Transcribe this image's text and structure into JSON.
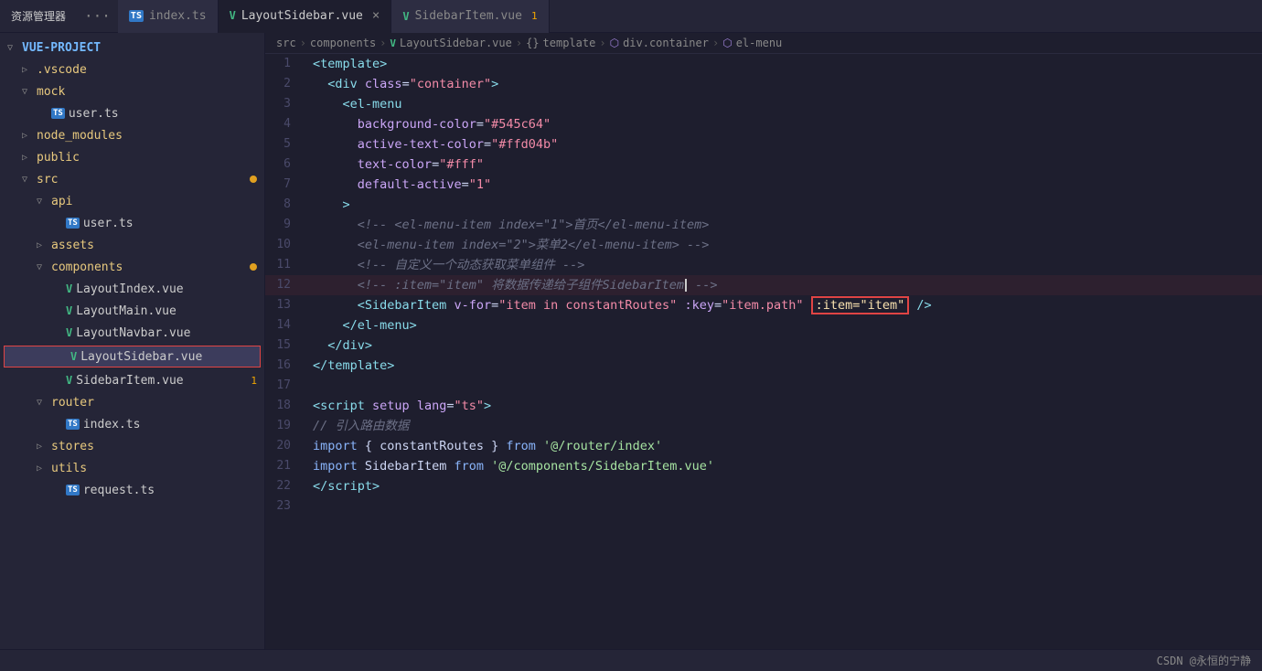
{
  "topbar": {
    "title": "资源管理器",
    "tabs": [
      {
        "id": "index-ts",
        "icon": "ts",
        "label": "index.ts",
        "active": false,
        "close": false,
        "badge": ""
      },
      {
        "id": "layout-sidebar",
        "icon": "vue",
        "label": "LayoutSidebar.vue",
        "active": true,
        "close": true,
        "badge": ""
      },
      {
        "id": "sidebar-item",
        "icon": "vue",
        "label": "SidebarItem.vue",
        "active": false,
        "close": false,
        "badge": "1"
      }
    ]
  },
  "breadcrumb": {
    "parts": [
      "src",
      "›",
      "components",
      "›",
      "LayoutSidebar.vue",
      "›",
      "{}",
      "template",
      "›",
      "div.container",
      "›",
      "el-menu"
    ]
  },
  "sidebar": {
    "project": "VUE-PROJECT",
    "items": [
      {
        "level": 1,
        "indent": 0,
        "arrow": "▷",
        "type": "folder",
        "name": ".vscode",
        "dot": false,
        "badge": ""
      },
      {
        "level": 1,
        "indent": 0,
        "arrow": "▽",
        "type": "folder",
        "name": "mock",
        "dot": false,
        "badge": ""
      },
      {
        "level": 2,
        "indent": 1,
        "arrow": "",
        "type": "ts",
        "name": "user.ts",
        "dot": false,
        "badge": ""
      },
      {
        "level": 1,
        "indent": 0,
        "arrow": "▷",
        "type": "folder",
        "name": "node_modules",
        "dot": false,
        "badge": ""
      },
      {
        "level": 1,
        "indent": 0,
        "arrow": "▷",
        "type": "folder",
        "name": "public",
        "dot": false,
        "badge": ""
      },
      {
        "level": 1,
        "indent": 0,
        "arrow": "▽",
        "type": "folder",
        "name": "src",
        "dot": true,
        "badge": ""
      },
      {
        "level": 2,
        "indent": 1,
        "arrow": "▽",
        "type": "folder",
        "name": "api",
        "dot": false,
        "badge": ""
      },
      {
        "level": 3,
        "indent": 2,
        "arrow": "",
        "type": "ts",
        "name": "user.ts",
        "dot": false,
        "badge": ""
      },
      {
        "level": 2,
        "indent": 1,
        "arrow": "▷",
        "type": "folder",
        "name": "assets",
        "dot": false,
        "badge": ""
      },
      {
        "level": 2,
        "indent": 1,
        "arrow": "▽",
        "type": "folder",
        "name": "components",
        "dot": true,
        "badge": ""
      },
      {
        "level": 3,
        "indent": 2,
        "arrow": "",
        "type": "vue",
        "name": "LayoutIndex.vue",
        "dot": false,
        "badge": ""
      },
      {
        "level": 3,
        "indent": 2,
        "arrow": "",
        "type": "vue",
        "name": "LayoutMain.vue",
        "dot": false,
        "badge": ""
      },
      {
        "level": 3,
        "indent": 2,
        "arrow": "",
        "type": "vue",
        "name": "LayoutNavbar.vue",
        "dot": false,
        "badge": ""
      },
      {
        "level": 3,
        "indent": 2,
        "arrow": "",
        "type": "vue",
        "name": "LayoutSidebar.vue",
        "dot": false,
        "badge": "",
        "selected": true
      },
      {
        "level": 3,
        "indent": 2,
        "arrow": "",
        "type": "vue",
        "name": "SidebarItem.vue",
        "dot": false,
        "badge": "1"
      },
      {
        "level": 2,
        "indent": 1,
        "arrow": "▽",
        "type": "folder",
        "name": "router",
        "dot": false,
        "badge": ""
      },
      {
        "level": 3,
        "indent": 2,
        "arrow": "",
        "type": "ts",
        "name": "index.ts",
        "dot": false,
        "badge": ""
      },
      {
        "level": 2,
        "indent": 1,
        "arrow": "▷",
        "type": "folder",
        "name": "stores",
        "dot": false,
        "badge": ""
      },
      {
        "level": 2,
        "indent": 1,
        "arrow": "▷",
        "type": "folder",
        "name": "utils",
        "dot": false,
        "badge": ""
      },
      {
        "level": 3,
        "indent": 2,
        "arrow": "",
        "type": "ts",
        "name": "request.ts",
        "dot": false,
        "badge": ""
      }
    ]
  },
  "editor": {
    "lines": [
      {
        "num": 1,
        "html": "<span class='c-tag'>&lt;template&gt;</span>"
      },
      {
        "num": 2,
        "html": "  <span class='c-tag'>&lt;div</span> <span class='c-attr'>class</span>=<span class='c-string'>\"container\"</span><span class='c-tag'>&gt;</span>"
      },
      {
        "num": 3,
        "html": "    <span class='c-tag'>&lt;el-menu</span>"
      },
      {
        "num": 4,
        "html": "      <span class='c-attr'>background-color</span>=<span class='c-string'>\"#545c64\"</span>"
      },
      {
        "num": 5,
        "html": "      <span class='c-attr'>active-text-color</span>=<span class='c-string'>\"#ffd04b\"</span>"
      },
      {
        "num": 6,
        "html": "      <span class='c-attr'>text-color</span>=<span class='c-string'>\"#fff\"</span>"
      },
      {
        "num": 7,
        "html": "      <span class='c-attr'>default-active</span>=<span class='c-string'>\"1\"</span>"
      },
      {
        "num": 8,
        "html": "    <span class='c-tag'>&gt;</span>"
      },
      {
        "num": 9,
        "html": "      <span class='c-comment'>&lt;!-- &lt;el-menu-item index=\"1\"&gt;首页&lt;/el-menu-item&gt;</span>"
      },
      {
        "num": 10,
        "html": "      <span class='c-comment'>&lt;el-menu-item index=\"2\"&gt;菜单2&lt;/el-menu-item&gt; --&gt;</span>"
      },
      {
        "num": 11,
        "html": "      <span class='c-comment'>&lt;!-- 自定义一个动态获取菜单组件 --&gt;</span>"
      },
      {
        "num": 12,
        "html": "      <span class='c-comment'>&lt;!-- :item=\"item\" 将数据传递给子组件SidebarItem</span><span class='inline-cursor'>|</span><span class='c-comment'> --&gt;</span>",
        "highlight": true
      },
      {
        "num": 13,
        "html": "      <span class='c-tag'>&lt;SidebarItem</span> <span class='c-attr'>v-for</span>=<span class='c-string'>\"item in constantRoutes\"</span> <span class='c-attr'>:key</span>=<span class='c-string'>\"item.path\"</span> <span class='c-yellow inline-red-box'>:item=\"item\"</span> <span class='c-tag'>/&gt;</span>"
      },
      {
        "num": 14,
        "html": "    <span class='c-tag'>&lt;/el-menu&gt;</span>"
      },
      {
        "num": 15,
        "html": "  <span class='c-tag'>&lt;/div&gt;</span>"
      },
      {
        "num": 16,
        "html": "<span class='c-tag'>&lt;/template&gt;</span>"
      },
      {
        "num": 17,
        "html": ""
      },
      {
        "num": 18,
        "html": "<span class='c-tag'>&lt;script</span> <span class='c-attr'>setup</span> <span class='c-attr'>lang</span>=<span class='c-string'>\"ts\"</span><span class='c-tag'>&gt;</span>"
      },
      {
        "num": 19,
        "html": "<span class='c-comment'>// 引入路由数据</span>"
      },
      {
        "num": 20,
        "html": "<span class='c-blue'>import</span> <span class='c-text'>{ constantRoutes }</span> <span class='c-blue'>from</span> <span class='c-import-path'>'@/router/index'</span>"
      },
      {
        "num": 21,
        "html": "<span class='c-blue'>import</span> <span class='c-text'>SidebarItem</span> <span class='c-blue'>from</span> <span class='c-import-path'>'@/components/SidebarItem.vue'</span>"
      },
      {
        "num": 22,
        "html": "<span class='c-tag'>&lt;/script&gt;</span>"
      },
      {
        "num": 23,
        "html": ""
      }
    ]
  },
  "bottombar": {
    "text": "CSDN @永恒的宁静"
  }
}
